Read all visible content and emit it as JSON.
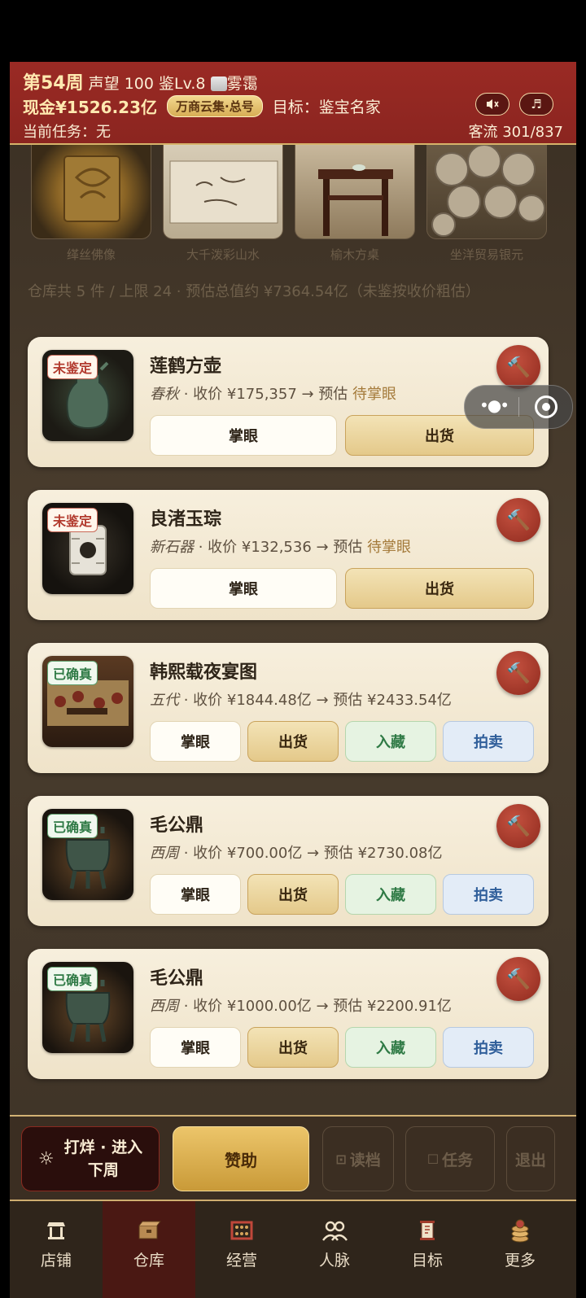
{
  "status": {
    "week": "第54周",
    "reputation": "声望 100",
    "level": "鉴Lv.8",
    "weather_icon": "fog-icon",
    "weather": "雾霭",
    "cash": "现金¥1526.23亿",
    "badge": "万商云集·总号",
    "goal": "目标：鉴宝名家",
    "mute_icon": "speaker-mute-icon",
    "music_icon": "music-note-icon",
    "task": "当前任务：无",
    "traffic": "客流 301/837"
  },
  "shelf": [
    {
      "caption": "缂丝佛像"
    },
    {
      "caption": "大千泼彩山水"
    },
    {
      "caption": "榆木方桌"
    },
    {
      "caption": "坐洋贸易银元"
    }
  ],
  "warehouse_summary": "仓库共 5 件 / 上限 24  ·  预估总值约 ¥7364.54亿（未鉴按收价粗估）",
  "items": [
    {
      "tag": "未鉴定",
      "name": "莲鹤方壶",
      "era": "春秋",
      "price": "· 收价 ¥175,357 → 预估 ",
      "estimate": "待掌眼",
      "btn_look": "掌眼",
      "btn_sell": "出货"
    },
    {
      "tag": "未鉴定",
      "name": "良渚玉琮",
      "era": "新石器",
      "price": "· 收价 ¥132,536 → 预估 ",
      "estimate": "待掌眼",
      "btn_look": "掌眼",
      "btn_sell": "出货"
    },
    {
      "tag": "已确真",
      "name": "韩熙载夜宴图",
      "era": "五代",
      "price": "· 收价 ¥1844.48亿 → 预估 ",
      "estimate": "¥2433.54亿",
      "btn_look": "掌眼",
      "btn_sell": "出货",
      "btn_store": "入藏",
      "btn_auction": "拍卖"
    },
    {
      "tag": "已确真",
      "name": "毛公鼎",
      "era": "西周",
      "price": "· 收价 ¥700.00亿 → 预估 ",
      "estimate": "¥2730.08亿",
      "btn_look": "掌眼",
      "btn_sell": "出货",
      "btn_store": "入藏",
      "btn_auction": "拍卖"
    },
    {
      "tag": "已确真",
      "name": "毛公鼎",
      "era": "西周",
      "price": "· 收价 ¥1000.00亿 → 预估 ",
      "estimate": "¥2200.91亿",
      "btn_look": "掌眼",
      "btn_sell": "出货",
      "btn_store": "入藏",
      "btn_auction": "拍卖"
    }
  ],
  "actions": {
    "next_week_line1": "打烊 · 进入",
    "next_week_line2": "下周",
    "sponsor": "赞助",
    "load": "读档",
    "tasks": "任务",
    "exit": "退出"
  },
  "tabs": [
    {
      "label": "店铺",
      "icon": "shop-icon"
    },
    {
      "label": "仓库",
      "icon": "warehouse-icon",
      "active": true
    },
    {
      "label": "经营",
      "icon": "abacus-icon"
    },
    {
      "label": "人脉",
      "icon": "people-icon"
    },
    {
      "label": "目标",
      "icon": "scroll-icon"
    },
    {
      "label": "更多",
      "icon": "coins-icon"
    }
  ],
  "colors": {
    "header_red": "#8b2520",
    "gold": "#d6b36a",
    "unverified": "#b23a2e",
    "verified": "#2f7a45",
    "auction_blue": "#2f5e9a"
  }
}
